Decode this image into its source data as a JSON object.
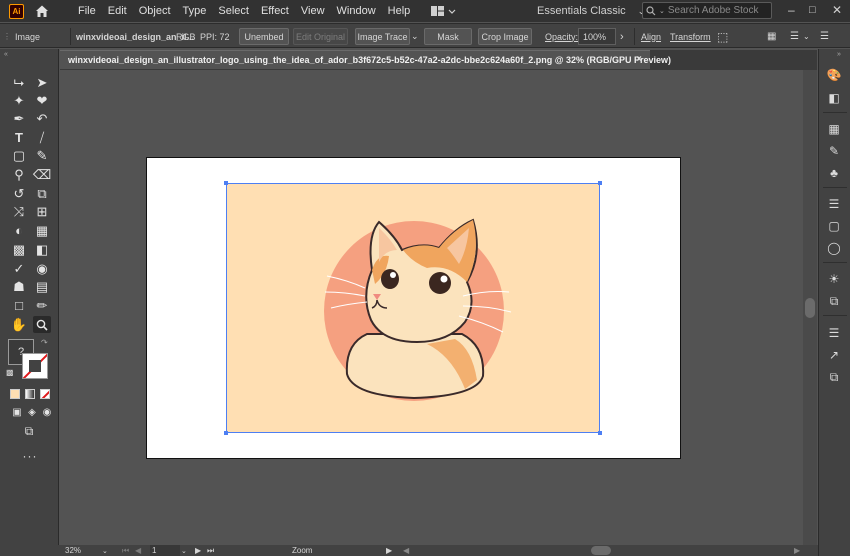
{
  "app": {
    "logo_text": "Ai"
  },
  "menu": {
    "items": [
      "File",
      "Edit",
      "Object",
      "Type",
      "Select",
      "Effect",
      "View",
      "Window",
      "Help"
    ]
  },
  "workspace": {
    "label": "Essentials Classic"
  },
  "search": {
    "placeholder": "Search Adobe Stock"
  },
  "control_bar": {
    "object_type": "Image",
    "file_name": "winxvideoai_design_an_il...",
    "color_mode": "RGB",
    "ppi_label": "PPI: 72",
    "unembed_label": "Unembed",
    "edit_original_label": "Edit Original",
    "image_trace_label": "Image Trace",
    "mask_label": "Mask",
    "crop_image_label": "Crop Image",
    "opacity_label": "Opacity:",
    "opacity_value": "100%",
    "align_label": "Align",
    "transform_label": "Transform"
  },
  "document": {
    "tab_title": "winxvideoai_design_an_illustrator_logo_using_the_idea_of_ador_b3f672c5-b52c-47a2-a2dc-bbe2c624a60f_2.png @ 32% (RGB/GPU Preview)",
    "close_glyph": "×"
  },
  "statusbar": {
    "zoom": "32%",
    "artboard_number": "1",
    "tool_name": "Zoom"
  },
  "colors": {
    "accent_selection": "#4d7ff3",
    "image_background": "#ffdfb3",
    "circle": "#f4a07c"
  },
  "icons": {
    "tools": [
      "selection-tool-icon",
      "direct-selection-tool-icon",
      "magic-wand-icon",
      "lasso-icon",
      "pen-tool-icon",
      "curvature-tool-icon",
      "type-tool-icon",
      "line-tool-icon",
      "rectangle-tool-icon",
      "paintbrush-icon",
      "shaper-tool-icon",
      "eraser-icon",
      "rotate-tool-icon",
      "scale-tool-icon",
      "width-tool-icon",
      "free-transform-icon",
      "shape-builder-icon",
      "perspective-grid-icon",
      "mesh-tool-icon",
      "gradient-tool-icon",
      "eyedropper-icon",
      "blend-tool-icon",
      "symbol-sprayer-icon",
      "column-graph-icon",
      "artboard-tool-icon",
      "slice-tool-icon",
      "hand-tool-icon",
      "zoom-tool-icon"
    ]
  }
}
